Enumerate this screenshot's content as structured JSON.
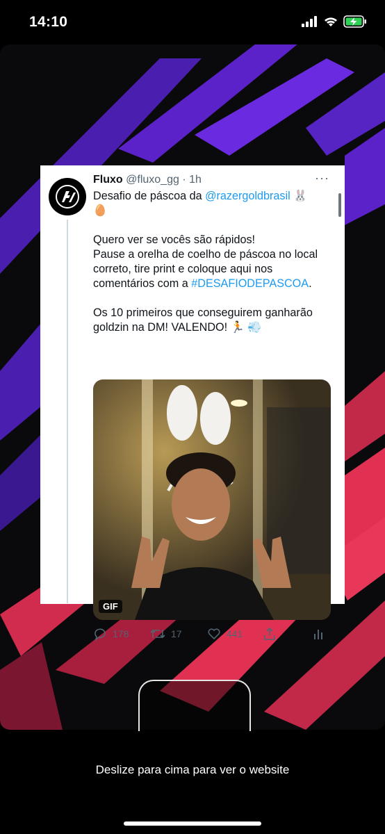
{
  "status_bar": {
    "time": "14:10"
  },
  "tweet": {
    "display_name": "Fluxo",
    "handle": "@fluxo_gg",
    "separator": "·",
    "time": "1h",
    "more": "···",
    "line1_text": "Desafio de páscoa da",
    "line1_mention": "@razergoldbrasil",
    "line1_emoji": "🐰",
    "line2_emoji": "🥚",
    "paragraph2_lines": [
      "Quero ver se vocês são rápidos!",
      "Pause a orelha de coelho de páscoa no local",
      "correto, tire print e coloque aqui nos"
    ],
    "paragraph2_last_text": "comentários com a",
    "paragraph2_hashtag": "#DESAFIODEPASCOA",
    "paragraph2_end": ".",
    "paragraph3_line1": "Os 10 primeiros que conseguirem ganharão",
    "paragraph3_line2": "goldzin na DM! VALENDO! 🏃 💨",
    "media_badge": "GIF",
    "replies": "178",
    "retweets": "17",
    "likes": "441"
  },
  "footer": {
    "swipe_hint": "Deslize para cima para ver o website"
  },
  "colors": {
    "background": "#000000",
    "purple_stripe": "#5b22c9",
    "red_stripe": "#e03153",
    "link": "#1d9bf0"
  },
  "icons": [
    "signal-icon",
    "wifi-icon",
    "battery-charging-icon",
    "fluxo-logo",
    "reply-icon",
    "retweet-icon",
    "like-icon",
    "share-icon",
    "analytics-icon"
  ]
}
